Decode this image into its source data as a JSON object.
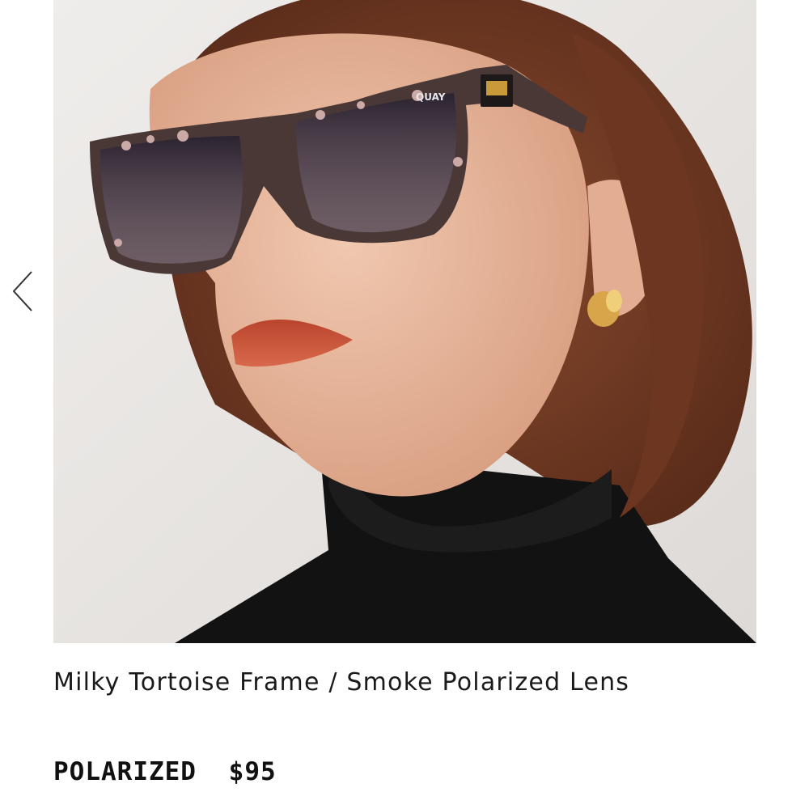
{
  "gallery": {
    "previous_icon": "chevron-left-icon",
    "image_subject": "model-wearing-sunglasses",
    "frame_logo_text": "QUAY"
  },
  "product": {
    "variant_name": "Milky Tortoise Frame / Smoke Polarized Lens",
    "lens_label": "POLARIZED",
    "price": "$95"
  },
  "colors": {
    "background": "#ffffff",
    "text": "#111111",
    "photo_background": "#e8e6e4"
  }
}
